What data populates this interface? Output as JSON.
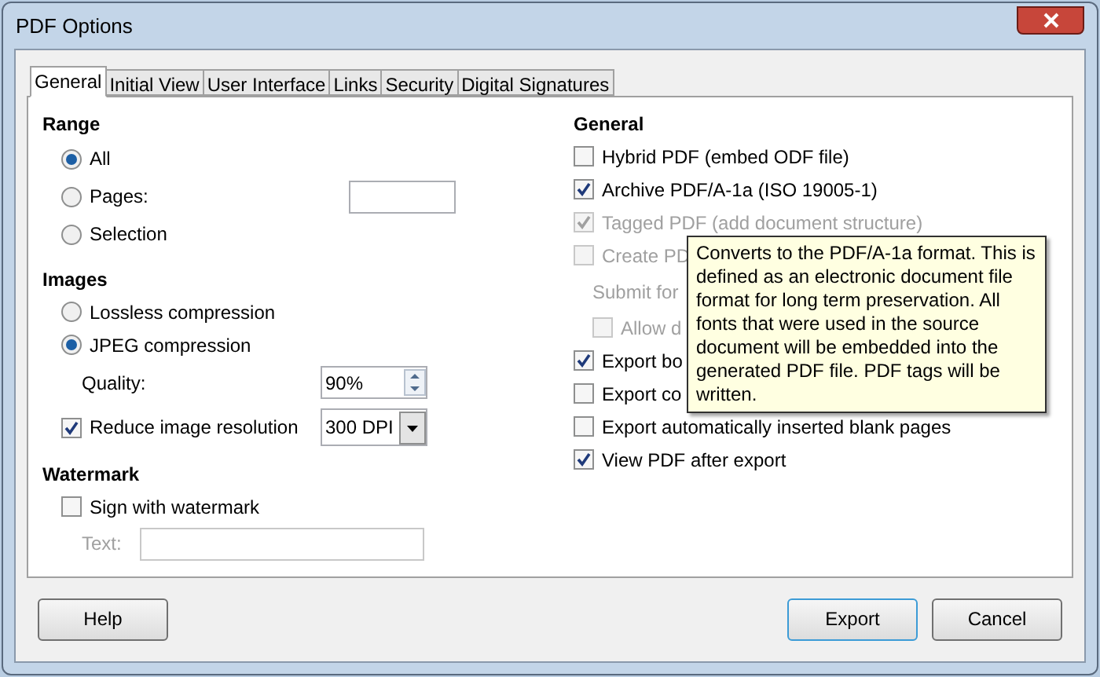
{
  "window": {
    "title": "PDF Options"
  },
  "tabs": [
    {
      "label": "General",
      "selected": true
    },
    {
      "label": "Initial View",
      "selected": false
    },
    {
      "label": "User Interface",
      "selected": false
    },
    {
      "label": "Links",
      "selected": false
    },
    {
      "label": "Security",
      "selected": false
    },
    {
      "label": "Digital Signatures",
      "selected": false
    }
  ],
  "range": {
    "title": "Range",
    "options": [
      {
        "label": "All",
        "selected": true
      },
      {
        "label": "Pages:",
        "selected": false
      },
      {
        "label": "Selection",
        "selected": false
      }
    ]
  },
  "images": {
    "title": "Images",
    "options": [
      {
        "label": "Lossless compression",
        "selected": false
      },
      {
        "label": "JPEG compression",
        "selected": true
      }
    ],
    "quality": {
      "label": "Quality:",
      "value": "90%"
    },
    "resolution": {
      "label": "Reduce image resolution",
      "checked": true,
      "value": "300 DPI"
    }
  },
  "watermark": {
    "title": "Watermark",
    "sign": {
      "label": "Sign with watermark",
      "checked": false
    },
    "text_field": {
      "label": "Text:",
      "disabled": true
    }
  },
  "general": {
    "title": "General",
    "items": [
      {
        "kind": "checkbox",
        "label": "Hybrid PDF (embed ODF file)",
        "checked": false,
        "disabled": false
      },
      {
        "kind": "checkbox",
        "label": "Archive PDF/A-1a (ISO 19005-1)",
        "checked": true,
        "disabled": false
      },
      {
        "kind": "checkbox",
        "label": "Tagged PDF (add document structure)",
        "checked": true,
        "disabled": true
      },
      {
        "kind": "checkbox",
        "label": "Create PD",
        "checked": false,
        "disabled": true,
        "children": [
          {
            "kind": "text",
            "label": "Submit for",
            "disabled": true
          },
          {
            "kind": "checkbox",
            "label": "Allow d",
            "checked": false,
            "disabled": true
          }
        ]
      },
      {
        "kind": "checkbox",
        "label": "Export bo",
        "checked": true,
        "disabled": false
      },
      {
        "kind": "checkbox",
        "label": "Export co",
        "checked": false,
        "disabled": false
      },
      {
        "kind": "checkbox",
        "label": "Export automatically inserted blank pages",
        "checked": false,
        "disabled": false
      },
      {
        "kind": "checkbox",
        "label": "View PDF after export",
        "checked": true,
        "disabled": false
      }
    ]
  },
  "tooltip": {
    "text": "Converts to the PDF/A-1a format. This is defined as an electronic document file format for long term preservation. All fonts that were used in the source document will be embedded into the generated PDF file. PDF tags will be written."
  },
  "buttons": [
    {
      "label": "Help",
      "default": false
    },
    {
      "label": "Export",
      "default": true
    },
    {
      "label": "Cancel",
      "default": false
    }
  ]
}
